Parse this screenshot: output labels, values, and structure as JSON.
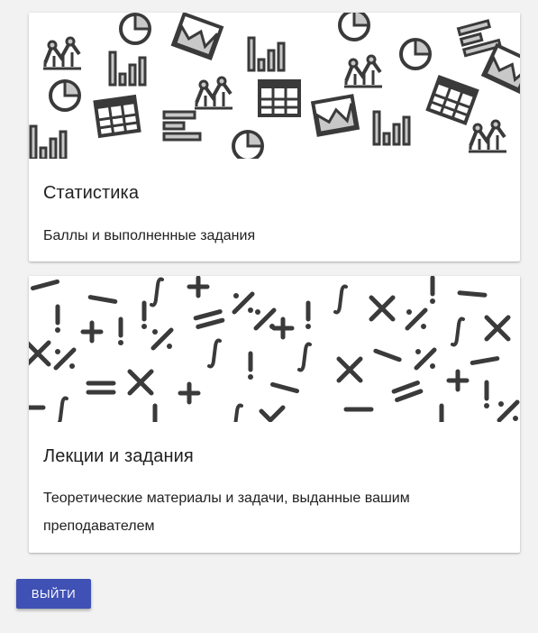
{
  "cards": [
    {
      "title": "Статистика",
      "description": "Баллы и выполненные задания"
    },
    {
      "title": "Лекции и задания",
      "description": "Теоретические материалы и задачи, выданные вашим преподавателем"
    }
  ],
  "logout_label": "ВЫЙТИ",
  "colors": {
    "accent": "#3f51b5",
    "icon_stroke": "#3a3a3a",
    "icon_fill": "#c8c8c8",
    "background": "#f2f2f2"
  }
}
